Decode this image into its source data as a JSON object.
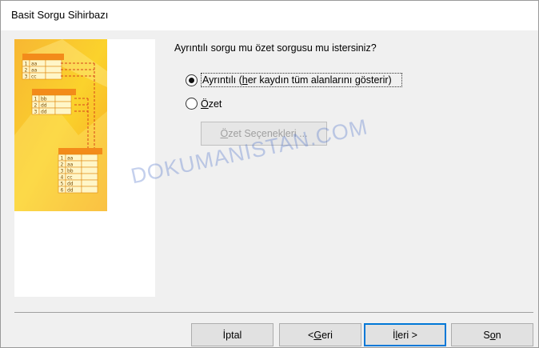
{
  "window": {
    "title": "Basit Sorgu Sihirbazı"
  },
  "illustration": {
    "table1": [
      [
        "1",
        "aa"
      ],
      [
        "2",
        "aa"
      ],
      [
        "3",
        "cc"
      ]
    ],
    "table2": [
      [
        "1",
        "bb"
      ],
      [
        "2",
        "dd"
      ],
      [
        "3",
        "dd"
      ]
    ],
    "table3": [
      [
        "1",
        "aa"
      ],
      [
        "2",
        "aa"
      ],
      [
        "3",
        "bb"
      ],
      [
        "4",
        "cc"
      ],
      [
        "5",
        "dd"
      ],
      [
        "6",
        "dd"
      ]
    ]
  },
  "main": {
    "question": "Ayrıntılı sorgu mu özet sorgusu mu istersiniz?",
    "option_detail": {
      "pre": "Ayrıntılı (",
      "accel": "h",
      "post": "er kaydın tüm alanlarını gösterir)",
      "checked": true
    },
    "option_summary": {
      "pre": "",
      "accel": "Ö",
      "post": "zet",
      "checked": false
    },
    "summary_options_button": {
      "accel": "Ö",
      "post": "zet Seçenekleri ..."
    }
  },
  "footer": {
    "cancel": "İptal",
    "back": {
      "pre": "< ",
      "accel": "G",
      "post": "eri"
    },
    "next": {
      "pre": "İ",
      "accel": "l",
      "post": "eri >"
    },
    "finish": {
      "pre": "S",
      "accel": "o",
      "post": "n"
    }
  },
  "watermark": "DOKUMANISTAN.COM",
  "colors": {
    "accent": "#0078d7",
    "illustration_yellow": "#f9c41b",
    "illustration_orange": "#f3a21a"
  }
}
